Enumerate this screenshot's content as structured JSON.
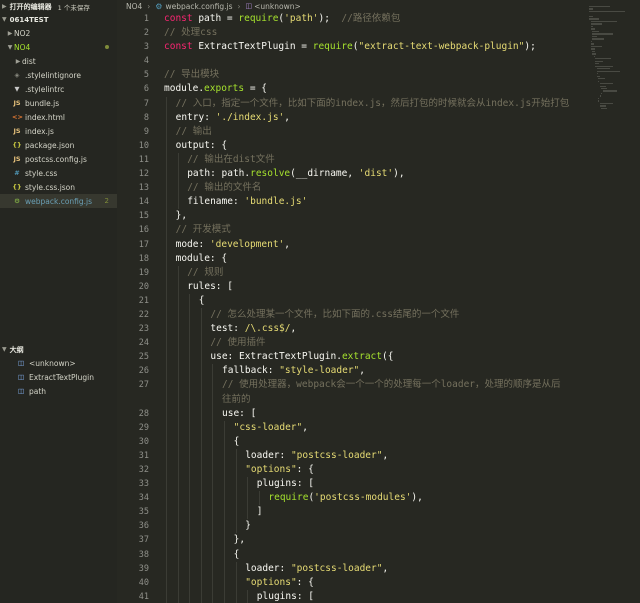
{
  "sidebar": {
    "open_editors_title": "打开的编辑器",
    "open_editors_note": "1 个未保存",
    "project_title": "0614TEST",
    "items": [
      {
        "label": "NO2",
        "kind": "folder"
      },
      {
        "label": "NO4",
        "kind": "folder-open"
      },
      {
        "label": "dist",
        "kind": "folder"
      },
      {
        "label": ".stylelintignore",
        "kind": "ignore",
        "icon": "◈"
      },
      {
        "label": ".stylelintrc",
        "kind": "lint",
        "icon": "▼"
      },
      {
        "label": "bundle.js",
        "kind": "js",
        "icon": "JS"
      },
      {
        "label": "index.html",
        "kind": "html",
        "icon": "<>"
      },
      {
        "label": "index.js",
        "kind": "js",
        "icon": "JS"
      },
      {
        "label": "package.json",
        "kind": "json",
        "icon": "{}"
      },
      {
        "label": "postcss.config.js",
        "kind": "js",
        "icon": "JS"
      },
      {
        "label": "style.css",
        "kind": "css",
        "icon": "#"
      },
      {
        "label": "style.css.json",
        "kind": "json",
        "icon": "{}"
      },
      {
        "label": "webpack.config.js",
        "kind": "cfg",
        "icon": "⚙",
        "count": "2"
      }
    ],
    "outline_title": "大纲",
    "outline_items": [
      {
        "label": "<unknown>",
        "icon": "◫"
      },
      {
        "label": "ExtractTextPlugin",
        "icon": "◫"
      },
      {
        "label": "path",
        "icon": "◫"
      }
    ]
  },
  "breadcrumb": {
    "folder": "NO4",
    "file": "webpack.config.js",
    "symbol": "<unknown>"
  },
  "code": {
    "lines": [
      {
        "n": "1",
        "i": 0,
        "t": [
          [
            "k",
            "const "
          ],
          [
            "p",
            "path = "
          ],
          [
            "f",
            "require"
          ],
          [
            "p",
            "("
          ],
          [
            "s",
            "'path'"
          ],
          [
            "p",
            ");  "
          ],
          [
            "c",
            "//路径依赖包"
          ]
        ]
      },
      {
        "n": "2",
        "i": 0,
        "t": [
          [
            "c",
            "// 处理css"
          ]
        ]
      },
      {
        "n": "3",
        "i": 0,
        "t": [
          [
            "k",
            "const "
          ],
          [
            "p",
            "ExtractTextPlugin = "
          ],
          [
            "f",
            "require"
          ],
          [
            "p",
            "("
          ],
          [
            "s",
            "\"extract-text-webpack-plugin\""
          ],
          [
            "p",
            ");"
          ]
        ]
      },
      {
        "n": "4",
        "i": 0,
        "t": []
      },
      {
        "n": "5",
        "i": 0,
        "t": [
          [
            "c",
            "// 导出模块"
          ]
        ]
      },
      {
        "n": "6",
        "i": 0,
        "t": [
          [
            "p",
            "module."
          ],
          [
            "f",
            "exports"
          ],
          [
            "p",
            " = {"
          ]
        ]
      },
      {
        "n": "7",
        "i": 1,
        "t": [
          [
            "c",
            "// 入口，指定一个文件，比如下面的index.js，然后打包的时候就会从index.js开始打包"
          ]
        ]
      },
      {
        "n": "8",
        "i": 1,
        "t": [
          [
            "p",
            "entry: "
          ],
          [
            "s",
            "'./index.js'"
          ],
          [
            "p",
            ","
          ]
        ]
      },
      {
        "n": "9",
        "i": 1,
        "t": [
          [
            "c",
            "// 输出"
          ]
        ]
      },
      {
        "n": "10",
        "i": 1,
        "t": [
          [
            "p",
            "output: {"
          ]
        ]
      },
      {
        "n": "11",
        "i": 2,
        "t": [
          [
            "c",
            "// 输出在dist文件"
          ]
        ]
      },
      {
        "n": "12",
        "i": 2,
        "t": [
          [
            "p",
            "path: path."
          ],
          [
            "f",
            "resolve"
          ],
          [
            "p",
            "(__dirname, "
          ],
          [
            "s",
            "'dist'"
          ],
          [
            "p",
            "),"
          ]
        ]
      },
      {
        "n": "13",
        "i": 2,
        "t": [
          [
            "c",
            "// 输出的文件名"
          ]
        ]
      },
      {
        "n": "14",
        "i": 2,
        "t": [
          [
            "p",
            "filename: "
          ],
          [
            "s",
            "'bundle.js'"
          ]
        ]
      },
      {
        "n": "15",
        "i": 1,
        "t": [
          [
            "p",
            "},"
          ]
        ]
      },
      {
        "n": "16",
        "i": 1,
        "t": [
          [
            "c",
            "// 开发模式"
          ]
        ]
      },
      {
        "n": "17",
        "i": 1,
        "t": [
          [
            "p",
            "mode: "
          ],
          [
            "s",
            "'development'"
          ],
          [
            "p",
            ","
          ]
        ]
      },
      {
        "n": "18",
        "i": 1,
        "t": [
          [
            "p",
            "module: {"
          ]
        ]
      },
      {
        "n": "19",
        "i": 2,
        "t": [
          [
            "c",
            "// 规则"
          ]
        ]
      },
      {
        "n": "20",
        "i": 2,
        "t": [
          [
            "p",
            "rules: ["
          ]
        ]
      },
      {
        "n": "21",
        "i": 3,
        "t": [
          [
            "p",
            "{"
          ]
        ]
      },
      {
        "n": "22",
        "i": 4,
        "t": [
          [
            "c",
            "// 怎么处理某一个文件，比如下面的.css结尾的一个文件"
          ]
        ]
      },
      {
        "n": "23",
        "i": 4,
        "t": [
          [
            "p",
            "test: "
          ],
          [
            "s",
            "/\\.css$/"
          ],
          [
            "p",
            ","
          ]
        ]
      },
      {
        "n": "24",
        "i": 4,
        "t": [
          [
            "c",
            "// 使用插件"
          ]
        ]
      },
      {
        "n": "25",
        "i": 4,
        "t": [
          [
            "p",
            "use: ExtractTextPlugin."
          ],
          [
            "f",
            "extract"
          ],
          [
            "p",
            "({"
          ]
        ]
      },
      {
        "n": "26",
        "i": 5,
        "t": [
          [
            "p",
            "fallback: "
          ],
          [
            "s",
            "\"style-loader\""
          ],
          [
            "p",
            ","
          ]
        ]
      },
      {
        "n": "27",
        "i": 5,
        "t": [
          [
            "c",
            "// 使用处理器，webpack会一个一个的处理每一个loader，处理的顺序是从后"
          ]
        ]
      },
      {
        "n": "",
        "i": 5,
        "t": [
          [
            "c",
            "往前的"
          ]
        ]
      },
      {
        "n": "28",
        "i": 5,
        "t": [
          [
            "p",
            "use: ["
          ]
        ]
      },
      {
        "n": "29",
        "i": 6,
        "t": [
          [
            "s",
            "\"css-loader\""
          ],
          [
            "p",
            ","
          ]
        ]
      },
      {
        "n": "30",
        "i": 6,
        "t": [
          [
            "p",
            "{"
          ]
        ]
      },
      {
        "n": "31",
        "i": 7,
        "t": [
          [
            "p",
            "loader: "
          ],
          [
            "s",
            "\"postcss-loader\""
          ],
          [
            "p",
            ","
          ]
        ]
      },
      {
        "n": "32",
        "i": 7,
        "t": [
          [
            "s",
            "\"options\""
          ],
          [
            "p",
            ": {"
          ]
        ]
      },
      {
        "n": "33",
        "i": 8,
        "t": [
          [
            "p",
            "plugins: ["
          ]
        ]
      },
      {
        "n": "34",
        "i": 9,
        "t": [
          [
            "f",
            "require"
          ],
          [
            "p",
            "("
          ],
          [
            "s",
            "'postcss-modules'"
          ],
          [
            "p",
            "),"
          ]
        ]
      },
      {
        "n": "35",
        "i": 8,
        "t": [
          [
            "p",
            "]"
          ]
        ]
      },
      {
        "n": "36",
        "i": 7,
        "t": [
          [
            "p",
            "}"
          ]
        ]
      },
      {
        "n": "37",
        "i": 6,
        "t": [
          [
            "p",
            "},"
          ]
        ]
      },
      {
        "n": "38",
        "i": 6,
        "t": [
          [
            "p",
            "{"
          ]
        ]
      },
      {
        "n": "39",
        "i": 7,
        "t": [
          [
            "p",
            "loader: "
          ],
          [
            "s",
            "\"postcss-loader\""
          ],
          [
            "p",
            ","
          ]
        ]
      },
      {
        "n": "40",
        "i": 7,
        "t": [
          [
            "s",
            "\"options\""
          ],
          [
            "p",
            ": {"
          ]
        ]
      },
      {
        "n": "41",
        "i": 8,
        "t": [
          [
            "p",
            "plugins: ["
          ]
        ]
      }
    ]
  }
}
